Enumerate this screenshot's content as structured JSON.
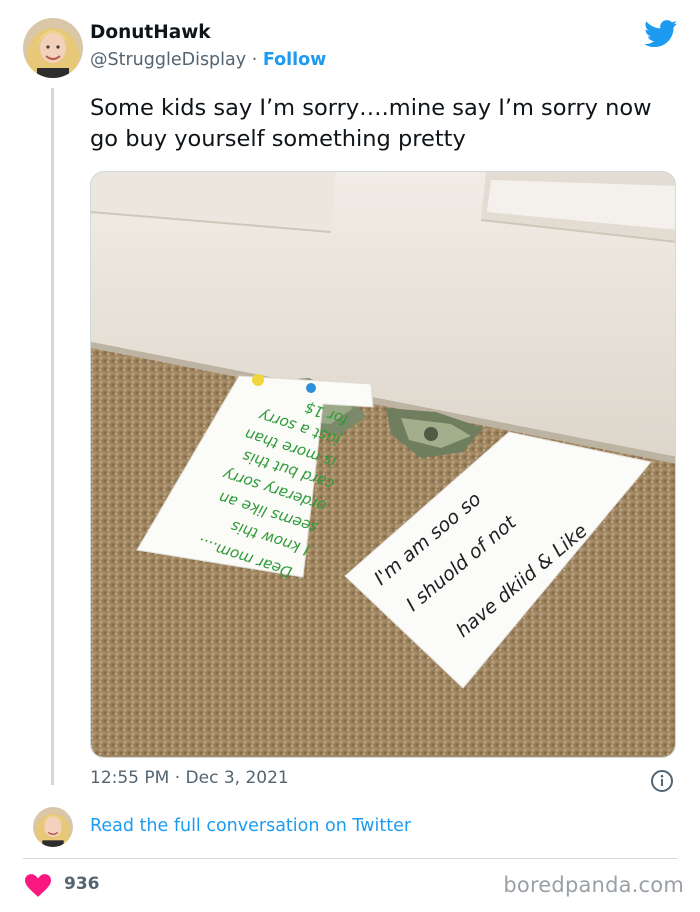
{
  "author": {
    "display_name": "DonutHawk",
    "handle": "@StruggleDisplay",
    "separator": "·",
    "follow_label": "Follow"
  },
  "tweet": {
    "text": "Some kids say I’m sorry….mine say I’m sorry now go buy yourself something pretty",
    "timestamp": "12:55 PM · Dec 3, 2021",
    "read_conversation_label": "Read the full conversation on Twitter",
    "likes": "936"
  },
  "photo": {
    "note_left_lines": [
      "Dear mom....",
      "I know this",
      "seems like an",
      "orderary sorry",
      "card but this",
      "is more than",
      "just a sorry",
      "for 1$"
    ],
    "note_right_lines": [
      "I'm am soo so",
      "I shuold of not",
      "have dkiid & Like"
    ]
  },
  "watermark": "boredpanda.com",
  "icons": {
    "brand": "twitter-bird-icon",
    "info": "info-icon",
    "like": "heart-icon"
  },
  "colors": {
    "link": "#1d9bf0",
    "heart": "#f91880",
    "secondary_text": "#536471"
  }
}
